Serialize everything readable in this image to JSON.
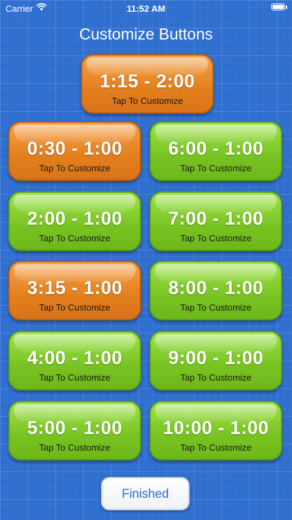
{
  "status_bar": {
    "carrier": "Carrier",
    "time": "11:52 AM",
    "wifi_icon": "wifi-icon",
    "battery_icon": "battery-icon"
  },
  "title": "Customize Buttons",
  "colors": {
    "background": "#2f6fd0",
    "green_tile": "#78c321",
    "orange_tile": "#e47f1c"
  },
  "tiles": [
    {
      "time": "1:15 - 2:00",
      "subtitle": "Tap To Customize",
      "color": "orange"
    },
    {
      "time": "0:30 - 1:00",
      "subtitle": "Tap To Customize",
      "color": "orange"
    },
    {
      "time": "6:00 - 1:00",
      "subtitle": "Tap To Customize",
      "color": "green"
    },
    {
      "time": "2:00 - 1:00",
      "subtitle": "Tap To Customize",
      "color": "green"
    },
    {
      "time": "7:00 - 1:00",
      "subtitle": "Tap To Customize",
      "color": "green"
    },
    {
      "time": "3:15 - 1:00",
      "subtitle": "Tap To Customize",
      "color": "orange"
    },
    {
      "time": "8:00 - 1:00",
      "subtitle": "Tap To Customize",
      "color": "green"
    },
    {
      "time": "4:00 - 1:00",
      "subtitle": "Tap To Customize",
      "color": "green"
    },
    {
      "time": "9:00 - 1:00",
      "subtitle": "Tap To Customize",
      "color": "green"
    },
    {
      "time": "5:00 - 1:00",
      "subtitle": "Tap To Customize",
      "color": "green"
    },
    {
      "time": "10:00 - 1:00",
      "subtitle": "Tap To Customize",
      "color": "green"
    }
  ],
  "finished_label": "Finished"
}
